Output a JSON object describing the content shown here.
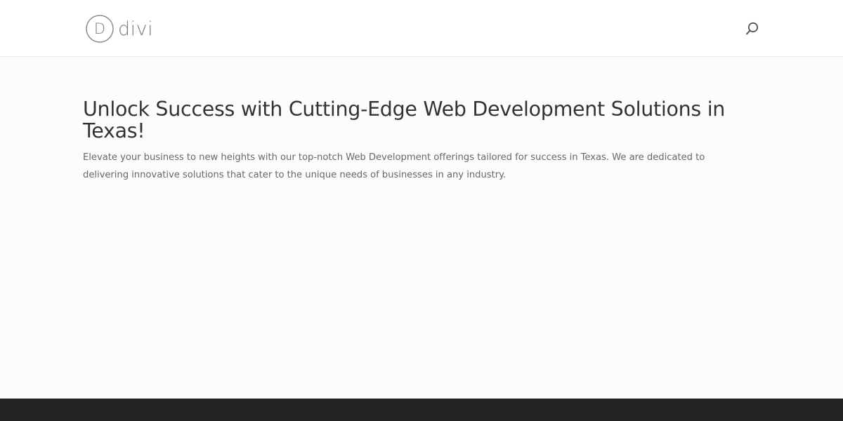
{
  "header": {
    "logo_text": "divi",
    "logo_letter": "D",
    "search_icon": "search-icon"
  },
  "hero": {
    "title": "Unlock Success with Cutting-Edge Web Development Solutions in Texas!",
    "description": "Elevate your business to new heights with our top-notch Web Development offerings tailored for success in Texas. We are dedicated to delivering innovative solutions that cater to the unique needs of businesses in any industry."
  },
  "colors": {
    "header_bg": "#ffffff",
    "content_bg": "#fdfcfd",
    "footer_bg": "#232323",
    "title_color": "#333336",
    "text_color": "#686868",
    "logo_color": "#7a7a80"
  }
}
